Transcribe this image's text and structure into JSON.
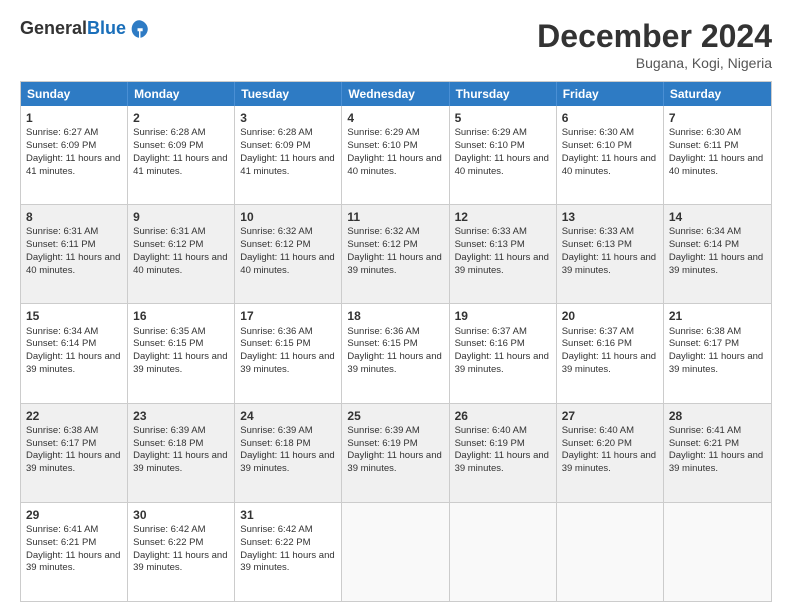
{
  "header": {
    "logo_general": "General",
    "logo_blue": "Blue",
    "month_title": "December 2024",
    "location": "Bugana, Kogi, Nigeria"
  },
  "days_of_week": [
    "Sunday",
    "Monday",
    "Tuesday",
    "Wednesday",
    "Thursday",
    "Friday",
    "Saturday"
  ],
  "weeks": [
    [
      {
        "day": "1",
        "info": "Sunrise: 6:27 AM\nSunset: 6:09 PM\nDaylight: 11 hours and 41 minutes.",
        "shaded": false
      },
      {
        "day": "2",
        "info": "Sunrise: 6:28 AM\nSunset: 6:09 PM\nDaylight: 11 hours and 41 minutes.",
        "shaded": false
      },
      {
        "day": "3",
        "info": "Sunrise: 6:28 AM\nSunset: 6:09 PM\nDaylight: 11 hours and 41 minutes.",
        "shaded": false
      },
      {
        "day": "4",
        "info": "Sunrise: 6:29 AM\nSunset: 6:10 PM\nDaylight: 11 hours and 40 minutes.",
        "shaded": false
      },
      {
        "day": "5",
        "info": "Sunrise: 6:29 AM\nSunset: 6:10 PM\nDaylight: 11 hours and 40 minutes.",
        "shaded": false
      },
      {
        "day": "6",
        "info": "Sunrise: 6:30 AM\nSunset: 6:10 PM\nDaylight: 11 hours and 40 minutes.",
        "shaded": false
      },
      {
        "day": "7",
        "info": "Sunrise: 6:30 AM\nSunset: 6:11 PM\nDaylight: 11 hours and 40 minutes.",
        "shaded": false
      }
    ],
    [
      {
        "day": "8",
        "info": "Sunrise: 6:31 AM\nSunset: 6:11 PM\nDaylight: 11 hours and 40 minutes.",
        "shaded": true
      },
      {
        "day": "9",
        "info": "Sunrise: 6:31 AM\nSunset: 6:12 PM\nDaylight: 11 hours and 40 minutes.",
        "shaded": true
      },
      {
        "day": "10",
        "info": "Sunrise: 6:32 AM\nSunset: 6:12 PM\nDaylight: 11 hours and 40 minutes.",
        "shaded": true
      },
      {
        "day": "11",
        "info": "Sunrise: 6:32 AM\nSunset: 6:12 PM\nDaylight: 11 hours and 39 minutes.",
        "shaded": true
      },
      {
        "day": "12",
        "info": "Sunrise: 6:33 AM\nSunset: 6:13 PM\nDaylight: 11 hours and 39 minutes.",
        "shaded": true
      },
      {
        "day": "13",
        "info": "Sunrise: 6:33 AM\nSunset: 6:13 PM\nDaylight: 11 hours and 39 minutes.",
        "shaded": true
      },
      {
        "day": "14",
        "info": "Sunrise: 6:34 AM\nSunset: 6:14 PM\nDaylight: 11 hours and 39 minutes.",
        "shaded": true
      }
    ],
    [
      {
        "day": "15",
        "info": "Sunrise: 6:34 AM\nSunset: 6:14 PM\nDaylight: 11 hours and 39 minutes.",
        "shaded": false
      },
      {
        "day": "16",
        "info": "Sunrise: 6:35 AM\nSunset: 6:15 PM\nDaylight: 11 hours and 39 minutes.",
        "shaded": false
      },
      {
        "day": "17",
        "info": "Sunrise: 6:36 AM\nSunset: 6:15 PM\nDaylight: 11 hours and 39 minutes.",
        "shaded": false
      },
      {
        "day": "18",
        "info": "Sunrise: 6:36 AM\nSunset: 6:15 PM\nDaylight: 11 hours and 39 minutes.",
        "shaded": false
      },
      {
        "day": "19",
        "info": "Sunrise: 6:37 AM\nSunset: 6:16 PM\nDaylight: 11 hours and 39 minutes.",
        "shaded": false
      },
      {
        "day": "20",
        "info": "Sunrise: 6:37 AM\nSunset: 6:16 PM\nDaylight: 11 hours and 39 minutes.",
        "shaded": false
      },
      {
        "day": "21",
        "info": "Sunrise: 6:38 AM\nSunset: 6:17 PM\nDaylight: 11 hours and 39 minutes.",
        "shaded": false
      }
    ],
    [
      {
        "day": "22",
        "info": "Sunrise: 6:38 AM\nSunset: 6:17 PM\nDaylight: 11 hours and 39 minutes.",
        "shaded": true
      },
      {
        "day": "23",
        "info": "Sunrise: 6:39 AM\nSunset: 6:18 PM\nDaylight: 11 hours and 39 minutes.",
        "shaded": true
      },
      {
        "day": "24",
        "info": "Sunrise: 6:39 AM\nSunset: 6:18 PM\nDaylight: 11 hours and 39 minutes.",
        "shaded": true
      },
      {
        "day": "25",
        "info": "Sunrise: 6:39 AM\nSunset: 6:19 PM\nDaylight: 11 hours and 39 minutes.",
        "shaded": true
      },
      {
        "day": "26",
        "info": "Sunrise: 6:40 AM\nSunset: 6:19 PM\nDaylight: 11 hours and 39 minutes.",
        "shaded": true
      },
      {
        "day": "27",
        "info": "Sunrise: 6:40 AM\nSunset: 6:20 PM\nDaylight: 11 hours and 39 minutes.",
        "shaded": true
      },
      {
        "day": "28",
        "info": "Sunrise: 6:41 AM\nSunset: 6:21 PM\nDaylight: 11 hours and 39 minutes.",
        "shaded": true
      }
    ],
    [
      {
        "day": "29",
        "info": "Sunrise: 6:41 AM\nSunset: 6:21 PM\nDaylight: 11 hours and 39 minutes.",
        "shaded": false
      },
      {
        "day": "30",
        "info": "Sunrise: 6:42 AM\nSunset: 6:22 PM\nDaylight: 11 hours and 39 minutes.",
        "shaded": false
      },
      {
        "day": "31",
        "info": "Sunrise: 6:42 AM\nSunset: 6:22 PM\nDaylight: 11 hours and 39 minutes.",
        "shaded": false
      },
      {
        "day": "",
        "info": "",
        "shaded": false,
        "empty": true
      },
      {
        "day": "",
        "info": "",
        "shaded": false,
        "empty": true
      },
      {
        "day": "",
        "info": "",
        "shaded": false,
        "empty": true
      },
      {
        "day": "",
        "info": "",
        "shaded": false,
        "empty": true
      }
    ]
  ]
}
